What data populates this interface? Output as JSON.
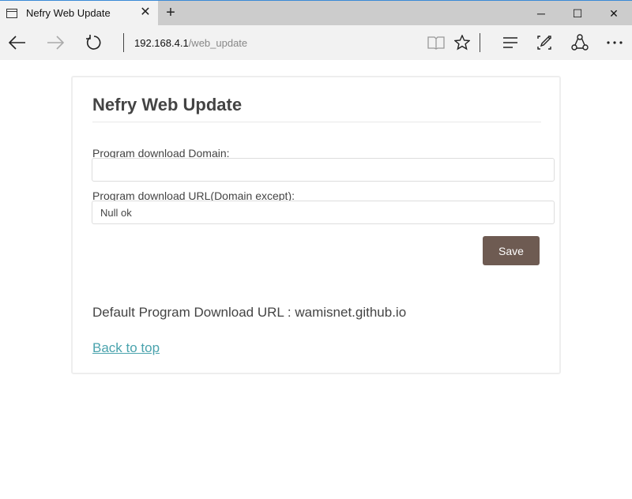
{
  "browser": {
    "tab_title": "Nefry Web Update",
    "new_tab_label": "+",
    "url_host": "192.168.4.1",
    "url_path": "/web_update",
    "window_controls": {
      "minimize": "─",
      "maximize": "☐",
      "close": "✕"
    },
    "tab_close": "✕"
  },
  "icons": {
    "back": "back-arrow-icon",
    "forward": "forward-arrow-icon",
    "refresh": "refresh-icon",
    "reading_view": "book-icon",
    "favorite": "star-icon",
    "hub": "hub-icon",
    "web_note": "pen-icon",
    "share": "share-icon",
    "more": "more-icon"
  },
  "page": {
    "title": "Nefry Web Update",
    "domain_label": "Program download Domain:",
    "domain_value": "",
    "url_label": "Program download URL(Domain except):",
    "url_placeholder": "Null ok",
    "save_label": "Save",
    "default_url_text": "Default Program Download URL : wamisnet.github.io",
    "back_link": "Back to top"
  },
  "colors": {
    "save_button": "#6e5b52",
    "link": "#4aa3ad",
    "text": "#444444"
  }
}
